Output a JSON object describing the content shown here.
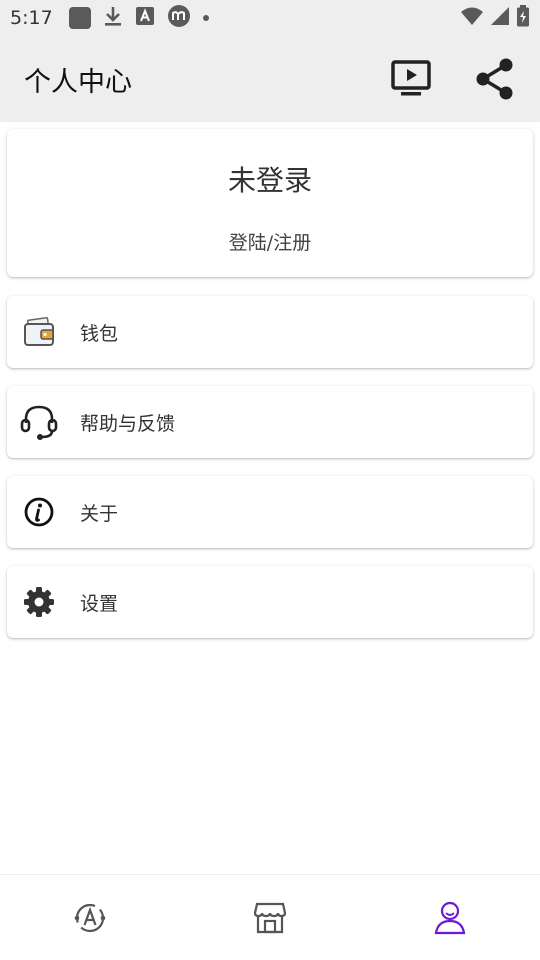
{
  "status_bar": {
    "time": "5:17",
    "icons": [
      "app-square-icon",
      "download-icon",
      "a-box-icon",
      "m-circle-icon",
      "dot-icon",
      "wifi-icon",
      "signal-icon",
      "battery-charging-icon"
    ]
  },
  "header": {
    "title": "个人中心",
    "actions": [
      "tv-play-icon",
      "share-icon"
    ]
  },
  "login": {
    "status": "未登录",
    "link": "登陆/注册"
  },
  "menu": {
    "items": [
      {
        "label": "钱包",
        "icon": "wallet-icon"
      },
      {
        "label": "帮助与反馈",
        "icon": "headset-icon"
      },
      {
        "label": "关于",
        "icon": "info-icon"
      },
      {
        "label": "设置",
        "icon": "gear-icon"
      }
    ]
  },
  "bottom_nav": {
    "items": [
      {
        "icon": "translate-orbit-icon",
        "active": false
      },
      {
        "icon": "store-icon",
        "active": false
      },
      {
        "icon": "person-icon",
        "active": true
      }
    ],
    "active_color": "#6a1bd6"
  },
  "colors": {
    "app_bar_bg": "#eeeeee",
    "accent": "#6a1bd6",
    "wallet_accent": "#e6a23c"
  }
}
